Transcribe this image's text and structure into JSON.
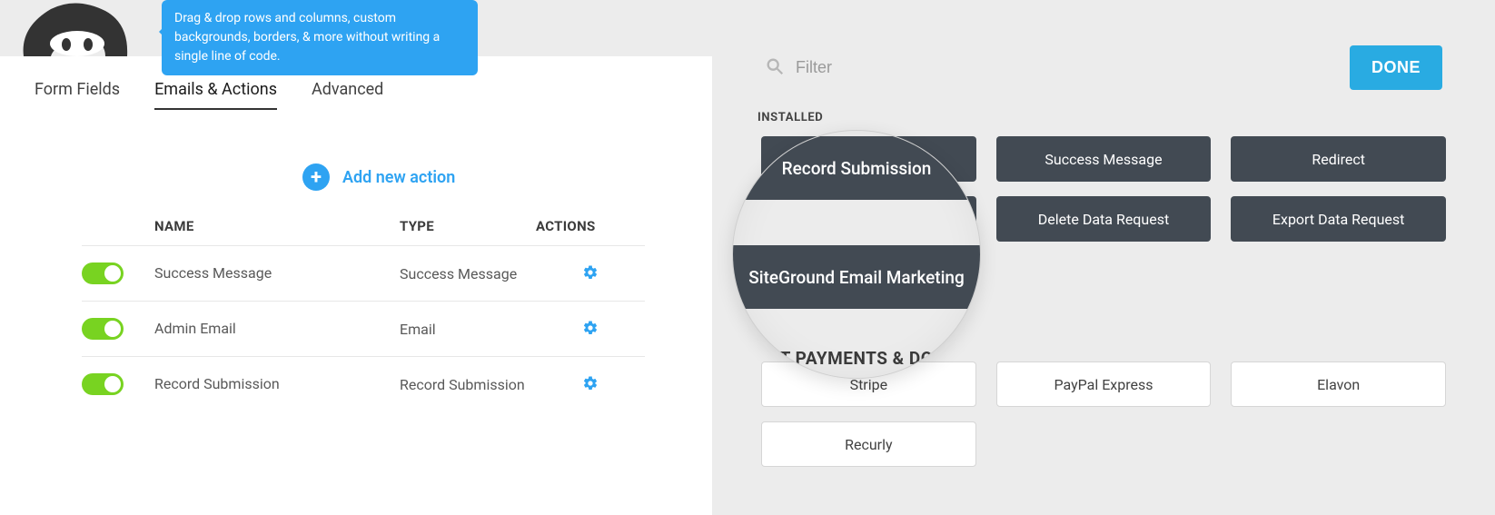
{
  "tooltip": {
    "text": "Drag & drop rows and columns, custom backgrounds, borders, & more without writing a single line of code."
  },
  "tabs": {
    "form_fields": "Form Fields",
    "emails_actions": "Emails & Actions",
    "advanced": "Advanced"
  },
  "add_action_label": "Add new action",
  "table": {
    "headers": {
      "name": "NAME",
      "type": "TYPE",
      "actions": "ACTIONS"
    },
    "rows": [
      {
        "name": "Success Message",
        "type": "Success Message"
      },
      {
        "name": "Admin Email",
        "type": "Email"
      },
      {
        "name": "Record Submission",
        "type": "Record Submission"
      }
    ]
  },
  "drawer": {
    "filter_placeholder": "Filter",
    "done": "DONE",
    "installed_label": "INSTALLED",
    "installed": [
      "Record Submission",
      "Success Message",
      "Redirect",
      "SiteGround Email Marketing",
      "Delete Data Request",
      "Export Data Request"
    ],
    "payments_label_fragment": "T PAYMENTS & DO",
    "payments": [
      "Stripe",
      "PayPal Express",
      "Elavon",
      "Recurly"
    ]
  },
  "magnifier": {
    "row1": "Record Submission",
    "row2": "SiteGround Email Marketing",
    "label": "T PAYMENTS & DO"
  },
  "colors": {
    "accent_blue": "#2ea3f2",
    "toggle_green": "#78d321",
    "card_dark": "#424a53",
    "panel_bg": "#ececec",
    "done_blue": "#29abe2"
  }
}
